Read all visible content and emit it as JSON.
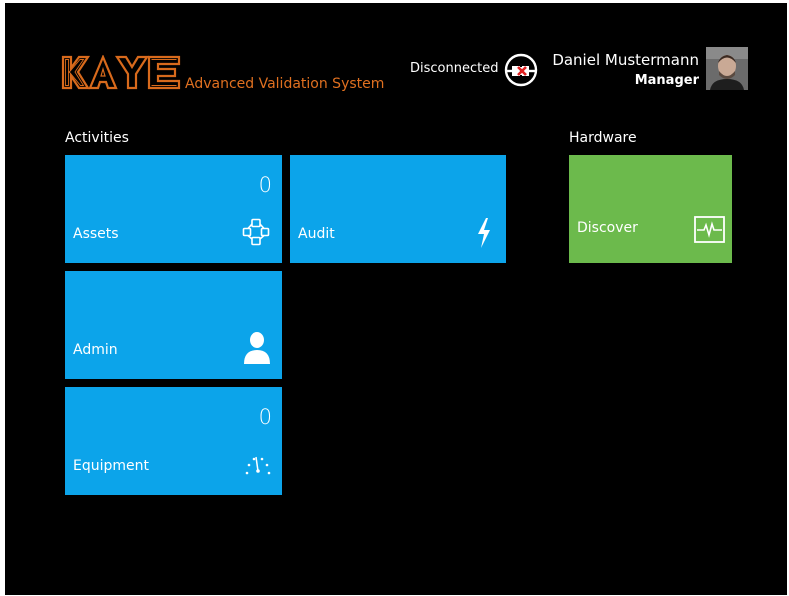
{
  "header": {
    "logo_text": "KAYE",
    "subtitle": "Advanced Validation System",
    "connection_status": "Disconnected",
    "connection_icon": "plug-disconnected-icon",
    "user_name": "Daniel Mustermann",
    "user_role": "Manager"
  },
  "sections": {
    "activities": "Activities",
    "hardware": "Hardware"
  },
  "tiles": {
    "assets": {
      "label": "Assets",
      "count": "0",
      "icon": "network-nodes-icon"
    },
    "audit": {
      "label": "Audit",
      "icon": "lightning-icon"
    },
    "admin": {
      "label": "Admin",
      "icon": "person-icon"
    },
    "equipment": {
      "label": "Equipment",
      "count": "0",
      "icon": "gauge-icon"
    },
    "discover": {
      "label": "Discover",
      "icon": "pulse-monitor-icon"
    }
  },
  "colors": {
    "background": "#000000",
    "tile_blue": "#0ca4ea",
    "tile_green": "#6cba4c",
    "brand_orange": "#e07020"
  }
}
